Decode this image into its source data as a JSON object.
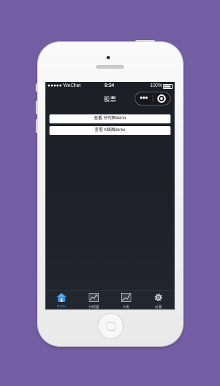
{
  "status_bar": {
    "carrier": "●●●●● WeChat",
    "time": "9:34",
    "battery": "100%"
  },
  "nav": {
    "title": "股票"
  },
  "buttons": [
    {
      "label": "查看 分时图demo"
    },
    {
      "label": "查看 K线图demo"
    }
  ],
  "tabbar": [
    {
      "label": "Home",
      "icon": "home-icon",
      "active": true
    },
    {
      "label": "分时图",
      "icon": "timeshare-chart-icon",
      "active": false
    },
    {
      "label": "K线",
      "icon": "kline-chart-icon",
      "active": false
    },
    {
      "label": "设置",
      "icon": "gear-icon",
      "active": false
    }
  ],
  "colors": {
    "background": "#735da3",
    "screen": "#1e2129",
    "active_tab": "#1e90ff"
  }
}
